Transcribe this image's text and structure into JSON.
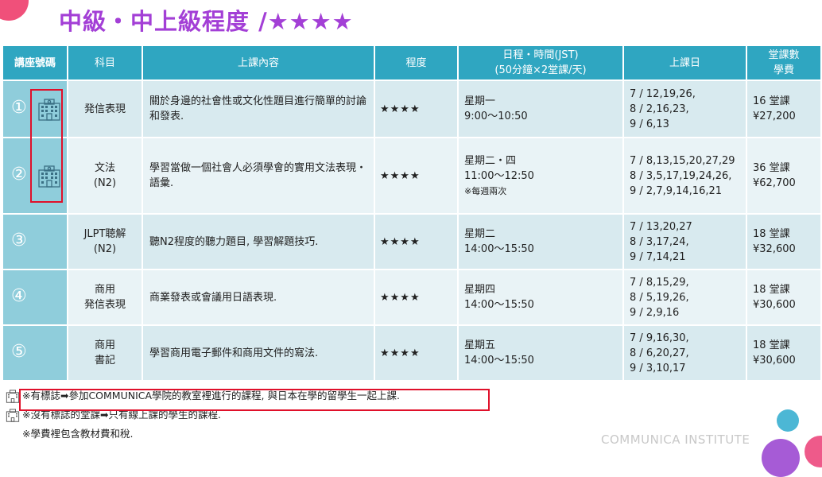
{
  "title": "中級・中上級程度 /★★★★",
  "headers": {
    "course_no": "講座號碼",
    "subject": "科目",
    "content": "上課內容",
    "level": "程度",
    "schedule_line1": "日程・時間(JST)",
    "schedule_line2": "(50分鐘×2堂課/天)",
    "dates": "上課日",
    "fee_line1": "堂課數",
    "fee_line2": "學費"
  },
  "rows": [
    {
      "num": "1",
      "subject_line1": "発信表現",
      "subject_line2": "",
      "content": "關於身邊的社會性或文化性題目進行簡單的討論和發表.",
      "level": "★★★★",
      "day": "星期一",
      "time": "9:00〜10:50",
      "note": "",
      "dates": [
        "7 / 12,19,26,",
        "8 / 2,16,23,",
        "9 / 6,13"
      ],
      "sessions": "16 堂課",
      "price": "¥27,200"
    },
    {
      "num": "2",
      "subject_line1": "文法",
      "subject_line2": "(N2)",
      "content": "學習當做一個社會人必須學會的實用文法表現・語彙.",
      "level": "★★★★",
      "day": "星期二・四",
      "time": "11:00〜12:50",
      "note": "※每週兩次",
      "dates": [
        "7 / 8,13,15,20,27,29",
        "8 / 3,5,17,19,24,26,",
        "9 / 2,7,9,14,16,21"
      ],
      "sessions": "36 堂課",
      "price": "¥62,700"
    },
    {
      "num": "3",
      "subject_line1": "JLPT聴解",
      "subject_line2": "(N2)",
      "content": "聽N2程度的聽力題目, 學習解題技巧.",
      "level": "★★★★",
      "day": "星期二",
      "time": "14:00〜15:50",
      "note": "",
      "dates": [
        "7 / 13,20,27",
        "8 / 3,17,24,",
        "9 / 7,14,21"
      ],
      "sessions": "18 堂課",
      "price": "¥32,600"
    },
    {
      "num": "4",
      "subject_line1": "商用",
      "subject_line2": "発信表現",
      "content": "商業發表或會議用日語表現.",
      "level": "★★★★",
      "day": "星期四",
      "time": "14:00〜15:50",
      "note": "",
      "dates": [
        "7 / 8,15,29,",
        "8 / 5,19,26,",
        "9 / 2,9,16"
      ],
      "sessions": "18 堂課",
      "price": "¥30,600"
    },
    {
      "num": "5",
      "subject_line1": "商用",
      "subject_line2": "書記",
      "content": "學習商用電子郵件和商用文件的寫法.",
      "level": "★★★★",
      "day": "星期五",
      "time": "14:00〜15:50",
      "note": "",
      "dates": [
        "7 / 9,16,30,",
        "8 / 6,20,27,",
        "9 / 3,10,17"
      ],
      "sessions": "18 堂課",
      "price": "¥30,600"
    }
  ],
  "num_symbols": [
    "①",
    "②",
    "③",
    "④",
    "⑤"
  ],
  "notes": {
    "note1": "※有標誌➡參加COMMUNICA學院的教室裡進行的課程, 與日本在學的留學生一起上課.",
    "note2": "※沒有標誌的堂課➡只有線上課的學生的課程.",
    "note3": "※學費裡包含教材費和稅."
  },
  "brand": "COMMUNICA INSTITUTE",
  "colors": {
    "title": "#a33fd6",
    "header_bg": "#2fa6c1",
    "num_bg": "#8fcddb",
    "row_a": "#d8eaef",
    "row_b": "#e9f3f6",
    "highlight": "#e0102a"
  },
  "icons": {
    "classroom": "school-building-icon"
  }
}
